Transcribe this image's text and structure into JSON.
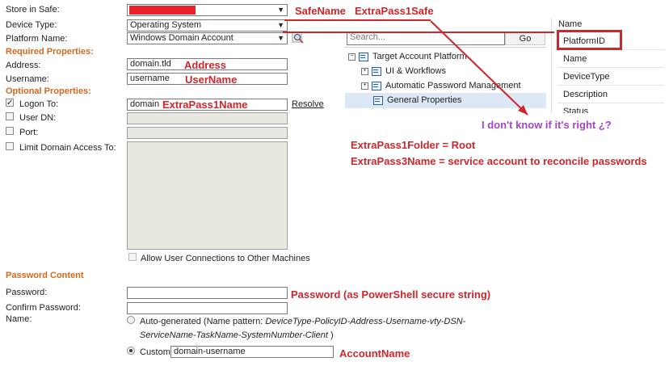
{
  "form": {
    "store_in_safe_label": "Store in Safe:",
    "device_type_label": "Device Type:",
    "device_type_value": "Operating System",
    "platform_name_label": "Platform Name:",
    "platform_name_value": "Windows Domain Account",
    "required_section": "Required Properties:",
    "address_label": "Address:",
    "address_value": "domain.tld",
    "username_label": "Username:",
    "username_value": "username",
    "optional_section": "Optional Properties:",
    "logon_to_label": "Logon To:",
    "logon_to_value": "domain",
    "resolve_link": "Resolve",
    "user_dn_label": "User DN:",
    "port_label": "Port:",
    "limit_domain_label": "Limit Domain Access To:",
    "allow_connections_label": "Allow User Connections to Other Machines",
    "password_section": "Password Content",
    "password_label": "Password:",
    "confirm_password_label": "Confirm Password:",
    "name_label": "Name:",
    "auto_generated_label": "Auto-generated",
    "name_pattern_prefix": "(Name pattern:",
    "name_pattern_value": "DeviceType-PolicyID-Address-Username-vty-DSN-",
    "name_pattern_value2": "ServiceName-TaskName-SystemNumber-Client",
    "name_pattern_suffix": ")",
    "custom_label": "Custom",
    "custom_value": "domain-username"
  },
  "tree": {
    "search_placeholder": "Search...",
    "go_button": "Go",
    "items": [
      {
        "label": "Target Account Platform"
      },
      {
        "label": "UI & Workflows"
      },
      {
        "label": "Automatic Password Management"
      },
      {
        "label": "General Properties"
      }
    ]
  },
  "props": {
    "header": "Name",
    "rows": [
      "PlatformID",
      "Name",
      "DeviceType",
      "Description",
      "Status"
    ]
  },
  "annotations": {
    "safe_name": "SafeName",
    "extra_pass1_safe": "ExtraPass1Safe",
    "address": "Address",
    "username": "UserName",
    "extra_pass1_name": "ExtraPass1Name",
    "not_sure": "I don't know if it's right ¿?",
    "extra_pass1_folder": "ExtraPass1Folder = Root",
    "extra_pass3_name": "ExtraPass3Name = service account to reconcile passwords",
    "password": "Password (as PowerShell secure string)",
    "account_name": "AccountName"
  },
  "colors": {
    "annotation_red": "#d0262b",
    "annotation_purple": "#a347c5",
    "section_orange": "#d2691e",
    "selection_blue": "#dde8f6"
  }
}
